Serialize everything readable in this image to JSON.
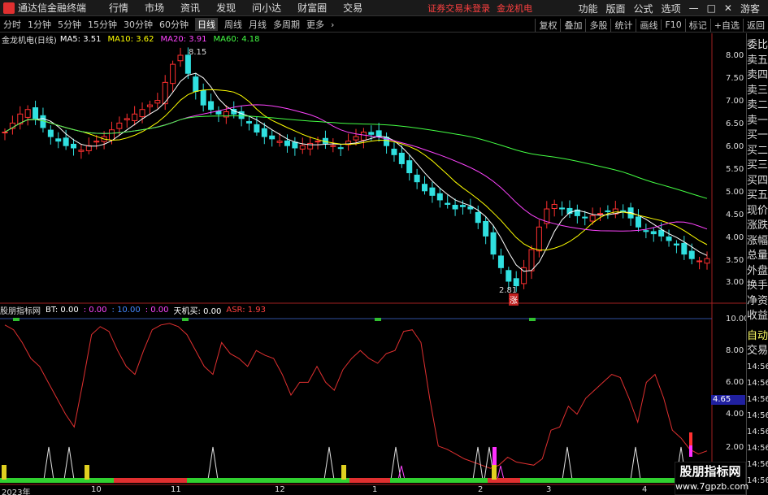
{
  "titlebar": {
    "app_title": "通达信金融终端",
    "menus": [
      "行情",
      "市场",
      "资讯",
      "发现",
      "问小达",
      "财富圈",
      "交易"
    ],
    "notice": "证券交易未登录",
    "stock": "金龙机电",
    "right_menus": [
      "功能",
      "版面",
      "公式",
      "选项"
    ],
    "guest": "游客"
  },
  "toolbar": {
    "periods": [
      "分时",
      "1分钟",
      "5分钟",
      "15分钟",
      "30分钟",
      "60分钟",
      "日线",
      "周线",
      "月线",
      "多周期",
      "更多"
    ],
    "active": "日线",
    "right": [
      "复权",
      "叠加",
      "多股",
      "统计",
      "画线",
      "F10",
      "标记",
      "+自选",
      "返回"
    ]
  },
  "main_chart": {
    "stock_label": "金龙机电(日线)",
    "ma5": "MA5: 3.51",
    "ma10": "MA10: 3.62",
    "ma20": "MA20: 3.91",
    "ma60": "MA60: 4.18",
    "high_label": "8.15",
    "low_label": "2.81",
    "low_mark": "涨",
    "yticks": [
      "8.00",
      "7.50",
      "7.00",
      "6.50",
      "6.00",
      "5.50",
      "5.00",
      "4.50",
      "4.00",
      "3.50",
      "3.00"
    ]
  },
  "sub_chart": {
    "name": "股朋指标网",
    "bt": "BT: 0.00",
    "v2": ": 0.00",
    "v3": ": 10.00",
    "v4": ": 0.00",
    "tjm": "天机买: 0.00",
    "asr": "ASR: 1.93",
    "yticks": [
      "10.00",
      "8.00",
      "6.00",
      "4.00",
      "2.00"
    ],
    "current": "4.65"
  },
  "xaxis": [
    "2023年",
    "10",
    "11",
    "12",
    "1",
    "2",
    "3",
    "4"
  ],
  "side_panel": {
    "items": [
      "委比",
      "卖五",
      "卖四",
      "卖三",
      "卖二",
      "卖一",
      "买一",
      "买二",
      "买三",
      "买四",
      "买五",
      "现价",
      "涨跌",
      "涨幅",
      "总量",
      "外盘",
      "换手",
      "净资",
      "收益"
    ],
    "auto": "自动",
    "trade": "交易",
    "times": [
      "14:56",
      "14:56",
      "14:56",
      "14:56",
      "14:56",
      "14:56",
      "14:56",
      "14:56",
      "14:56",
      "14:56"
    ]
  },
  "watermark": {
    "line1": "股朋指标网",
    "line2": "www.7gpzb.com"
  },
  "chart_data": {
    "type": "candlestick",
    "price_series": [
      6.3,
      6.5,
      6.7,
      6.8,
      6.6,
      6.4,
      6.2,
      6.1,
      6.0,
      5.95,
      5.9,
      6.0,
      6.1,
      6.2,
      6.35,
      6.5,
      6.6,
      6.7,
      6.8,
      6.9,
      7.0,
      7.4,
      7.8,
      8.0,
      7.6,
      7.2,
      6.9,
      6.8,
      6.7,
      6.75,
      6.7,
      6.6,
      6.5,
      6.3,
      6.2,
      6.15,
      6.1,
      6.0,
      5.95,
      6.0,
      6.05,
      6.1,
      6.05,
      6.0,
      5.95,
      6.1,
      6.2,
      6.3,
      6.25,
      6.2,
      6.0,
      5.8,
      5.6,
      5.4,
      5.2,
      5.0,
      4.9,
      4.8,
      4.7,
      4.6,
      4.65,
      4.6,
      4.3,
      4.0,
      3.6,
      3.3,
      3.0,
      2.9,
      3.3,
      3.7,
      4.2,
      4.6,
      4.7,
      4.6,
      4.5,
      4.45,
      4.4,
      4.45,
      4.5,
      4.55,
      4.6,
      4.55,
      4.4,
      4.2,
      4.1,
      4.05,
      4.0,
      3.9,
      3.8,
      3.6,
      3.5,
      3.45,
      3.5
    ],
    "oscillator": [
      9.6,
      9.3,
      8.5,
      7.5,
      7.0,
      6.0,
      5.0,
      4.0,
      3.2,
      6.0,
      9.0,
      9.5,
      9.2,
      8.0,
      7.0,
      6.5,
      8.0,
      9.3,
      9.6,
      9.7,
      9.5,
      9.0,
      8.0,
      7.0,
      6.5,
      8.5,
      7.8,
      7.5,
      7.0,
      8.0,
      7.7,
      7.5,
      6.5,
      5.2,
      6.0,
      6.0,
      7.0,
      6.0,
      5.5,
      6.8,
      7.5,
      8.0,
      7.5,
      7.2,
      7.8,
      8.0,
      9.2,
      9.3,
      8.5,
      5.0,
      2.0,
      1.8,
      1.5,
      1.2,
      1.0,
      0.8,
      0.6,
      0.8,
      1.3,
      1.0,
      0.9,
      0.8,
      1.2,
      3.0,
      3.2,
      4.5,
      4.0,
      5.0,
      5.5,
      6.0,
      6.5,
      6.3,
      5.0,
      3.5,
      6.0,
      6.5,
      5.0,
      3.0,
      2.5,
      1.8,
      1.5,
      1.7
    ]
  }
}
